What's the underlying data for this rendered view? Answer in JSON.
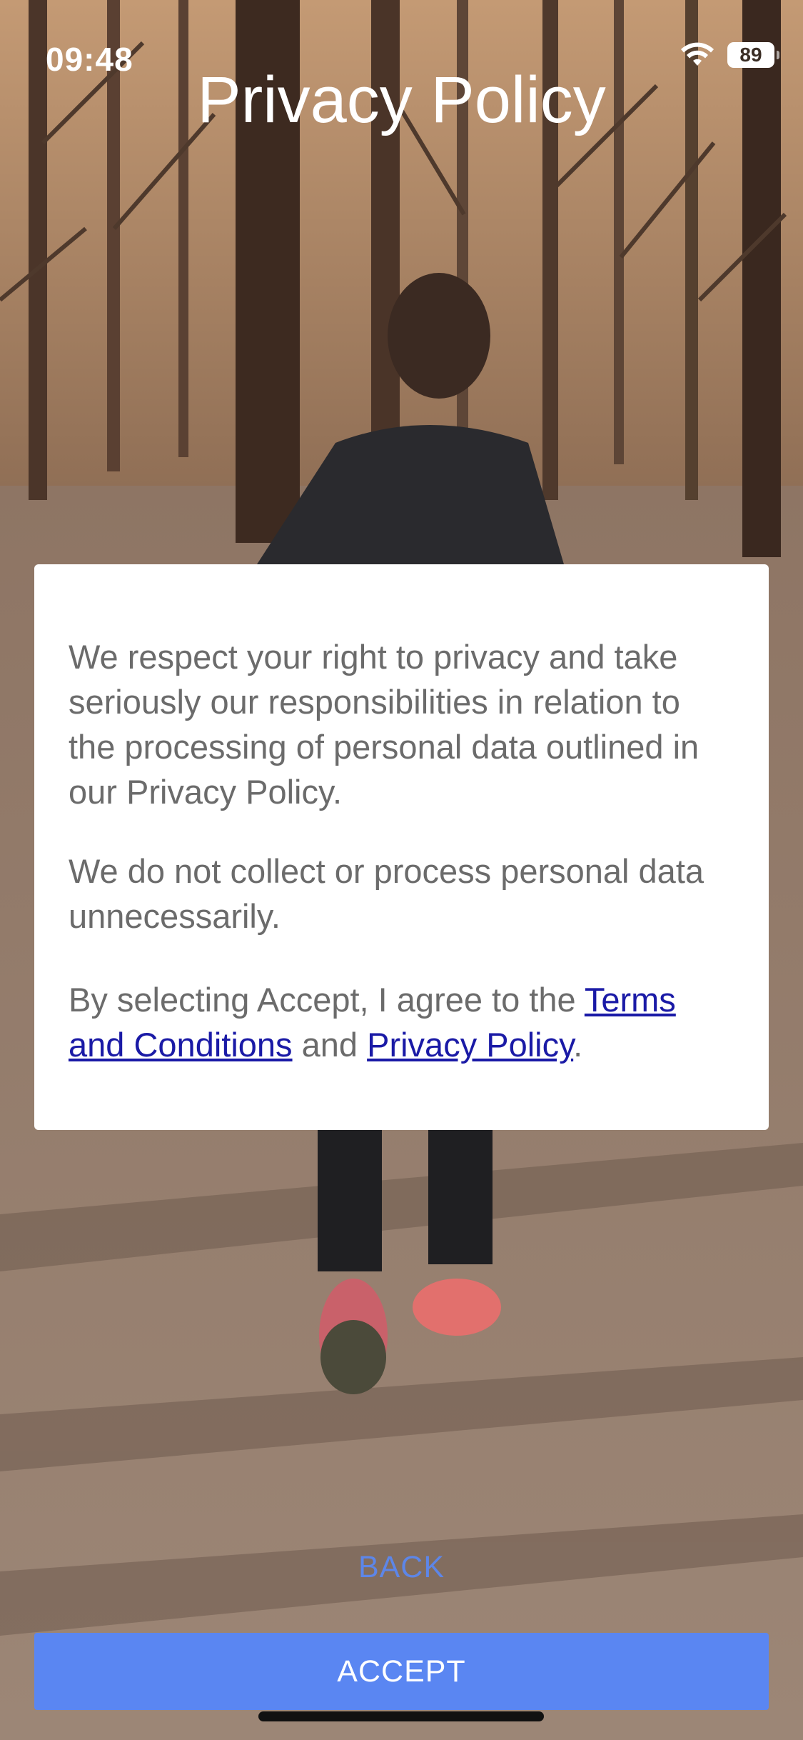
{
  "status_bar": {
    "time": "09:48",
    "battery": "89",
    "icons": [
      "wifi-icon",
      "battery-icon"
    ]
  },
  "header": {
    "title": "Privacy Policy"
  },
  "card": {
    "paragraph_1": "We respect your right to privacy and take seriously our responsibilities in relation to the processing of personal data outlined in our Privacy Policy.",
    "paragraph_2": "We do not collect or process personal data unnecessarily.",
    "consent": {
      "prefix": "By selecting Accept, I agree to the ",
      "terms_link": "Terms and Conditions",
      "middle": " and ",
      "privacy_link": "Privacy Policy",
      "suffix": "."
    }
  },
  "buttons": {
    "back": "BACK",
    "accept": "ACCEPT"
  },
  "colors": {
    "accent": "#5a86f2",
    "back_text": "#5d86e8",
    "link": "#1a1aa6",
    "body_text": "#6b6b6b"
  }
}
